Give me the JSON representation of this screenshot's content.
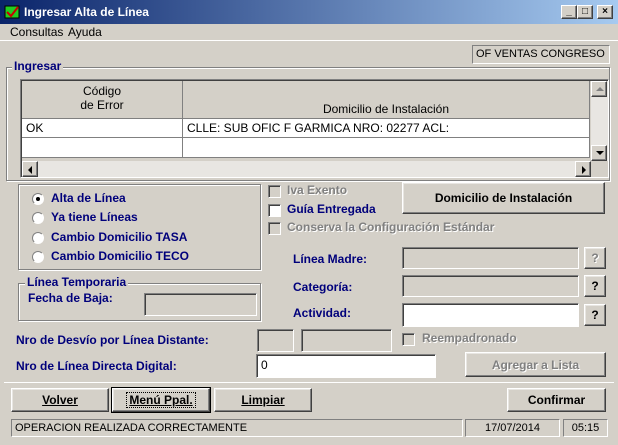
{
  "window": {
    "title": "Ingresar Alta de Línea",
    "caption_buttons": [
      "_",
      "□",
      "×"
    ]
  },
  "menu": [
    "Consultas",
    "Ayuda"
  ],
  "office": "OF VENTAS CONGRESO",
  "ingresar": {
    "title": "Ingresar",
    "columns": [
      "Código de Error",
      "Domicilio de Instalación"
    ],
    "rows": [
      [
        "OK",
        "CLLE: SUB OFIC F GARMICA NRO: 02277 ACL:"
      ]
    ]
  },
  "options": {
    "items": [
      {
        "label": "Alta de Línea",
        "selected": true
      },
      {
        "label": "Ya tiene Líneas",
        "selected": false
      },
      {
        "label": "Cambio Domicilio TASA",
        "selected": false
      },
      {
        "label": "Cambio Domicilio TECO",
        "selected": false
      }
    ]
  },
  "checks": {
    "iva": "Iva Exento",
    "guia": "Guía Entregada",
    "conserva": "Conserva la Configuración Estándar",
    "reempadronado": "Reempadronado"
  },
  "buttons": {
    "domicilio": "Domicilio de Instalación",
    "agregar": "Agregar a Lista",
    "volver": "Volver",
    "menu": "Menú Ppal.",
    "limpiar": "Limpiar",
    "confirmar": "Confirmar",
    "help": "?"
  },
  "fields": {
    "linea_madre": "Línea Madre:",
    "categoria": "Categoría:",
    "actividad": "Actividad:",
    "desvio": "Nro de Desvío por Línea Distante:",
    "directa": "Nro de Línea Directa Digital:",
    "directa_value": "0"
  },
  "temporaria": {
    "title": "Línea Temporaria",
    "fecha": "Fecha de Baja:"
  },
  "status": {
    "message": "OPERACION REALIZADA CORRECTAMENTE",
    "date": "17/07/2014",
    "time": "05:15"
  }
}
